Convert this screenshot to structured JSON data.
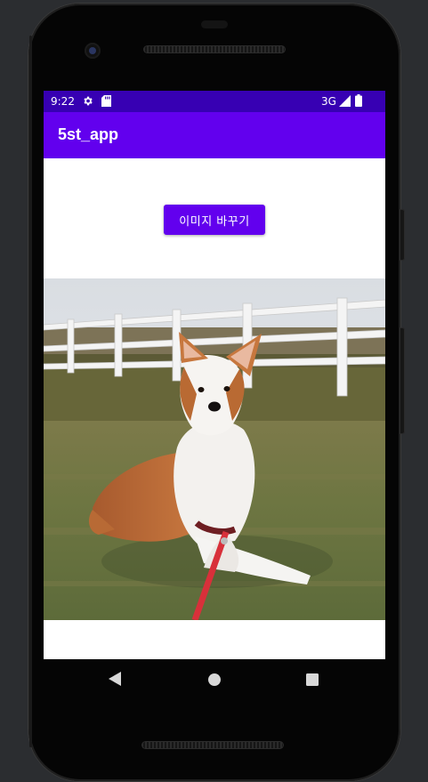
{
  "status_bar": {
    "time": "9:22",
    "network": "3G",
    "icons": [
      "settings-icon",
      "sd-card-icon",
      "signal-icon",
      "battery-icon"
    ],
    "background": "#3700b3"
  },
  "app_bar": {
    "title": "5st_app",
    "background": "#6200ee"
  },
  "main": {
    "change_image_button_label": "이미지 바꾸기",
    "button_color": "#6200ee",
    "image": "dog-photo"
  },
  "nav_bar": {
    "buttons": [
      "back-icon",
      "home-icon",
      "recents-icon"
    ]
  }
}
